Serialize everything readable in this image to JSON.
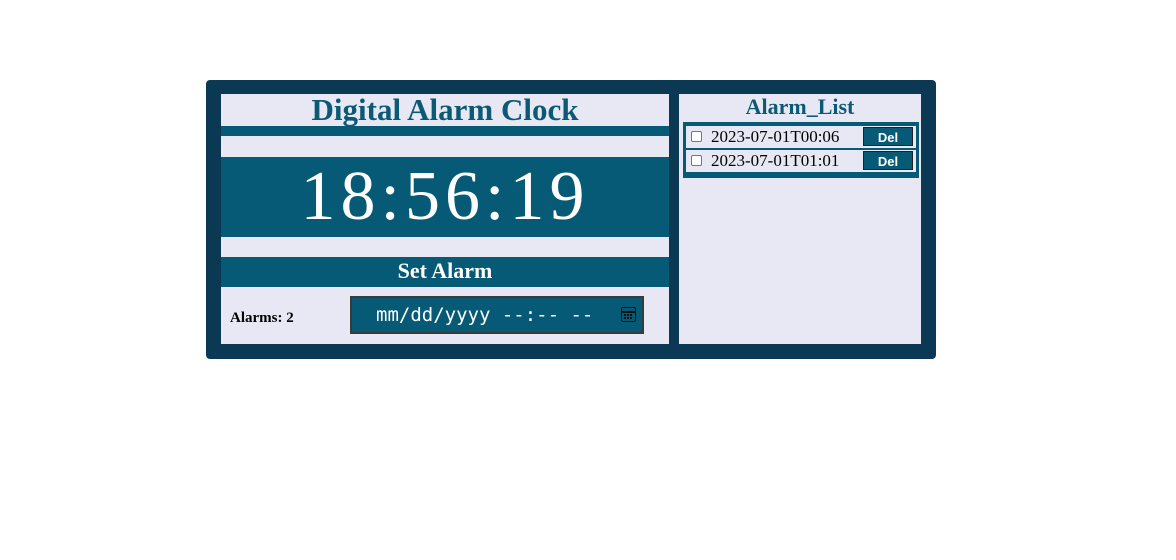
{
  "app": {
    "title": "Digital Alarm Clock",
    "clock_time": "18:56:19",
    "set_alarm_label": "Set Alarm",
    "alarms_count_label": "Alarms: 2",
    "datetime_input": {
      "placeholder": "mm/dd/yyyy --:-- --",
      "icon": "calendar-icon"
    }
  },
  "alarm_list": {
    "title": "Alarm_List",
    "items": [
      {
        "checked": false,
        "value": "2023-07-01T00:06",
        "delete_label": "Del"
      },
      {
        "checked": false,
        "value": "2023-07-01T01:01",
        "delete_label": "Del"
      }
    ]
  },
  "colors": {
    "frame": "#0b3954",
    "panel": "#e8e8f4",
    "accent": "#075a75",
    "title_text": "#0b5a75"
  }
}
